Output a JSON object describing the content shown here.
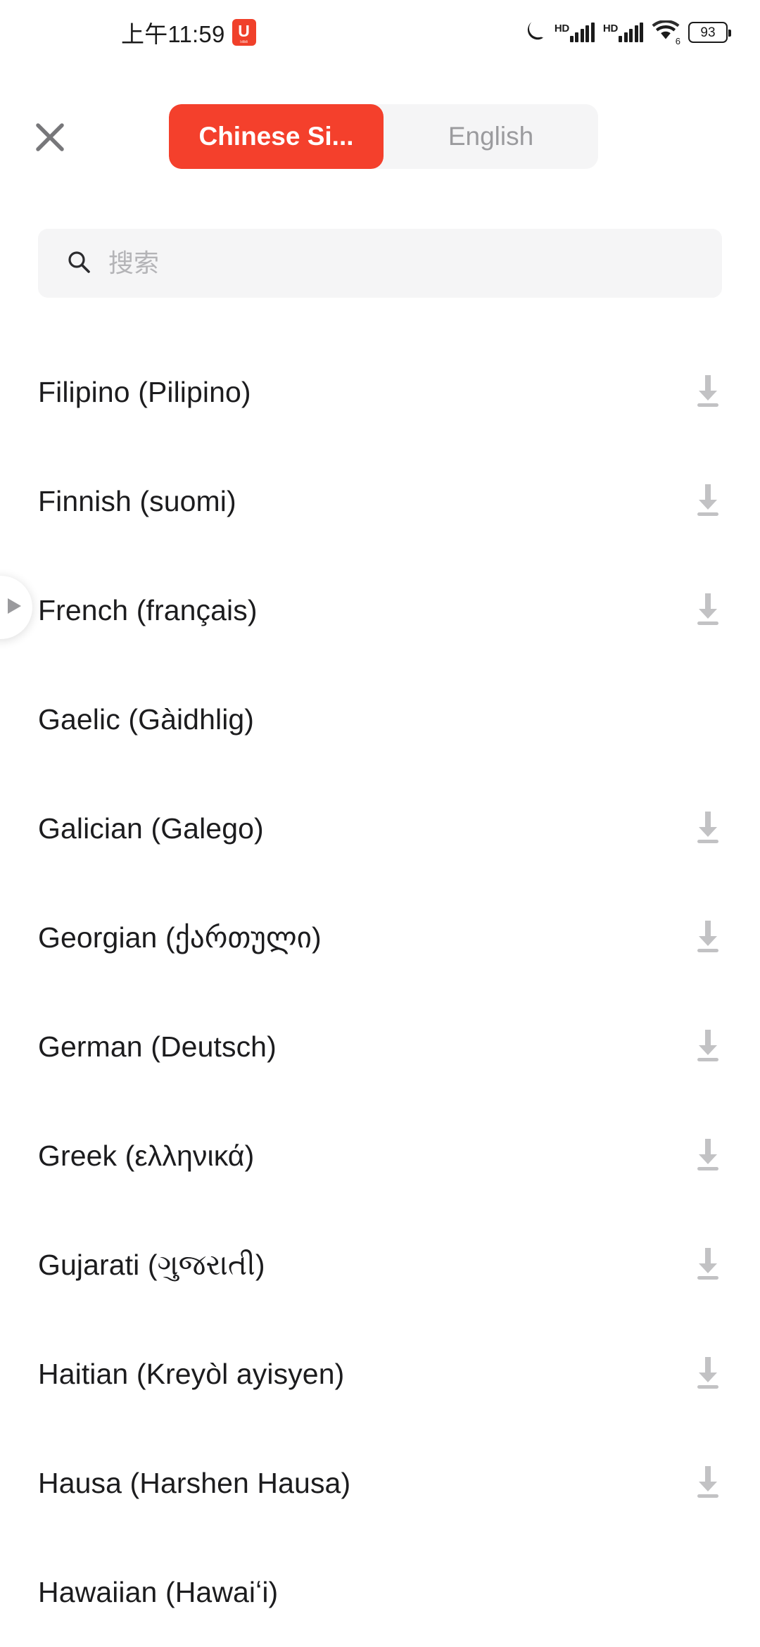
{
  "status_bar": {
    "time": "上午11:59",
    "app_badge_letter": "U",
    "app_badge_sub": "bilibili",
    "dnd_icon": "moon-icon",
    "sim1_label": "HD",
    "sim2_label": "HD",
    "wifi_icon": "wifi-icon",
    "wifi_generation": "6",
    "battery_level": "93"
  },
  "header": {
    "close_icon": "close-icon",
    "tabs": [
      {
        "label": "Chinese Si...",
        "active": true
      },
      {
        "label": "English",
        "active": false
      }
    ]
  },
  "search": {
    "icon": "search-icon",
    "placeholder": "搜索",
    "value": ""
  },
  "side_handle": {
    "icon": "play-triangle-icon"
  },
  "colors": {
    "accent_red": "#f4402c",
    "tab_track": "#f5f5f6",
    "search_bg": "#f5f5f6",
    "text_primary": "#1c1c1e",
    "text_muted": "#9b9b9e",
    "download_icon": "#c2c2c4"
  },
  "language_list": [
    {
      "english": "Filipino",
      "native": "(Pilipino)",
      "downloadable": true
    },
    {
      "english": "Finnish",
      "native": "(suomi)",
      "downloadable": true
    },
    {
      "english": "French",
      "native": "(français)",
      "downloadable": true
    },
    {
      "english": "Gaelic",
      "native": "(Gàidhlig)",
      "downloadable": false
    },
    {
      "english": "Galician",
      "native": "(Galego)",
      "downloadable": true
    },
    {
      "english": "Georgian",
      "native": "(ქართული)",
      "downloadable": true
    },
    {
      "english": "German",
      "native": "(Deutsch)",
      "downloadable": true
    },
    {
      "english": "Greek",
      "native": "(ελληνικά)",
      "downloadable": true
    },
    {
      "english": "Gujarati",
      "native": "(ગુજરાતી)",
      "downloadable": true
    },
    {
      "english": "Haitian",
      "native": "(Kreyòl ayisyen)",
      "downloadable": true
    },
    {
      "english": "Hausa",
      "native": "(Harshen Hausa)",
      "downloadable": true
    },
    {
      "english": "Hawaiian",
      "native": "(Hawaiʻi)",
      "downloadable": false
    }
  ]
}
